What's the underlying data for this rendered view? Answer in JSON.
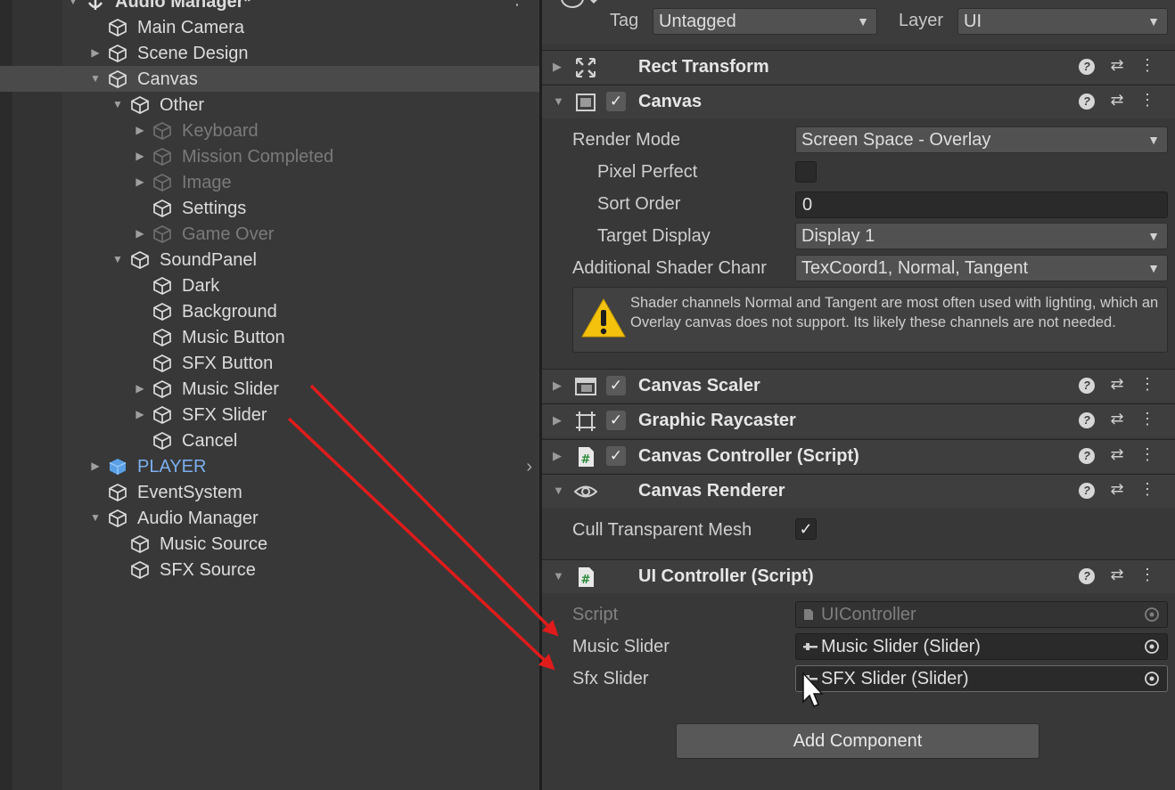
{
  "hierarchy": {
    "items": [
      {
        "label": "Audio Manager*",
        "depth": 0,
        "fold": "open",
        "style": "scene"
      },
      {
        "label": "Main Camera",
        "depth": 1,
        "fold": "none",
        "style": "normal"
      },
      {
        "label": "Scene Design",
        "depth": 1,
        "fold": "closed",
        "style": "normal"
      },
      {
        "label": "Canvas",
        "depth": 1,
        "fold": "open",
        "style": "selected"
      },
      {
        "label": "Other",
        "depth": 2,
        "fold": "open",
        "style": "normal"
      },
      {
        "label": "Keyboard",
        "depth": 3,
        "fold": "closed",
        "style": "dim"
      },
      {
        "label": "Mission Completed",
        "depth": 3,
        "fold": "closed",
        "style": "dim"
      },
      {
        "label": "Image",
        "depth": 3,
        "fold": "closed",
        "style": "dim"
      },
      {
        "label": "Settings",
        "depth": 3,
        "fold": "none",
        "style": "normal"
      },
      {
        "label": "Game Over",
        "depth": 3,
        "fold": "closed",
        "style": "dim"
      },
      {
        "label": "SoundPanel",
        "depth": 2,
        "fold": "open",
        "style": "normal"
      },
      {
        "label": "Dark",
        "depth": 3,
        "fold": "none",
        "style": "normal"
      },
      {
        "label": "Background",
        "depth": 3,
        "fold": "none",
        "style": "normal"
      },
      {
        "label": "Music Button",
        "depth": 3,
        "fold": "none",
        "style": "normal"
      },
      {
        "label": "SFX Button",
        "depth": 3,
        "fold": "none",
        "style": "normal"
      },
      {
        "label": "Music Slider",
        "depth": 3,
        "fold": "closed",
        "style": "normal"
      },
      {
        "label": "SFX Slider",
        "depth": 3,
        "fold": "closed",
        "style": "normal"
      },
      {
        "label": "Cancel",
        "depth": 3,
        "fold": "none",
        "style": "normal"
      },
      {
        "label": "PLAYER",
        "depth": 1,
        "fold": "closed",
        "style": "prefab"
      },
      {
        "label": "EventSystem",
        "depth": 1,
        "fold": "none",
        "style": "normal"
      },
      {
        "label": "Audio Manager",
        "depth": 1,
        "fold": "open",
        "style": "normal"
      },
      {
        "label": "Music Source",
        "depth": 2,
        "fold": "none",
        "style": "normal"
      },
      {
        "label": "SFX Source",
        "depth": 2,
        "fold": "none",
        "style": "normal"
      }
    ]
  },
  "inspector": {
    "tag_label": "Tag",
    "tag_value": "Untagged",
    "layer_label": "Layer",
    "layer_value": "UI",
    "components": {
      "rect_transform": "Rect Transform",
      "canvas": "Canvas",
      "canvas_scaler": "Canvas Scaler",
      "graphic_raycaster": "Graphic Raycaster",
      "canvas_controller": "Canvas Controller (Script)",
      "canvas_renderer": "Canvas Renderer",
      "ui_controller": "UI Controller (Script)"
    },
    "canvas": {
      "render_mode_label": "Render Mode",
      "render_mode_value": "Screen Space - Overlay",
      "pixel_perfect_label": "Pixel Perfect",
      "sort_order_label": "Sort Order",
      "sort_order_value": "0",
      "target_display_label": "Target Display",
      "target_display_value": "Display 1",
      "shader_channels_label": "Additional Shader Chanr",
      "shader_channels_value": "TexCoord1, Normal, Tangent",
      "warning": "Shader channels Normal and Tangent are most often used with lighting, which an Overlay canvas does not support. Its likely these channels are not needed."
    },
    "canvas_renderer": {
      "cull_label": "Cull Transparent Mesh"
    },
    "ui_controller": {
      "script_label": "Script",
      "script_value": "UIController",
      "music_slider_label": "Music Slider",
      "music_slider_value": "Music Slider (Slider)",
      "sfx_slider_label": "Sfx Slider",
      "sfx_slider_value": "SFX Slider (Slider)"
    },
    "add_component": "Add Component"
  },
  "colors": {
    "annotation_arrow": "#e01b1b",
    "prefab_text": "#7bb0f0",
    "warning_yellow": "#f4c20d"
  }
}
